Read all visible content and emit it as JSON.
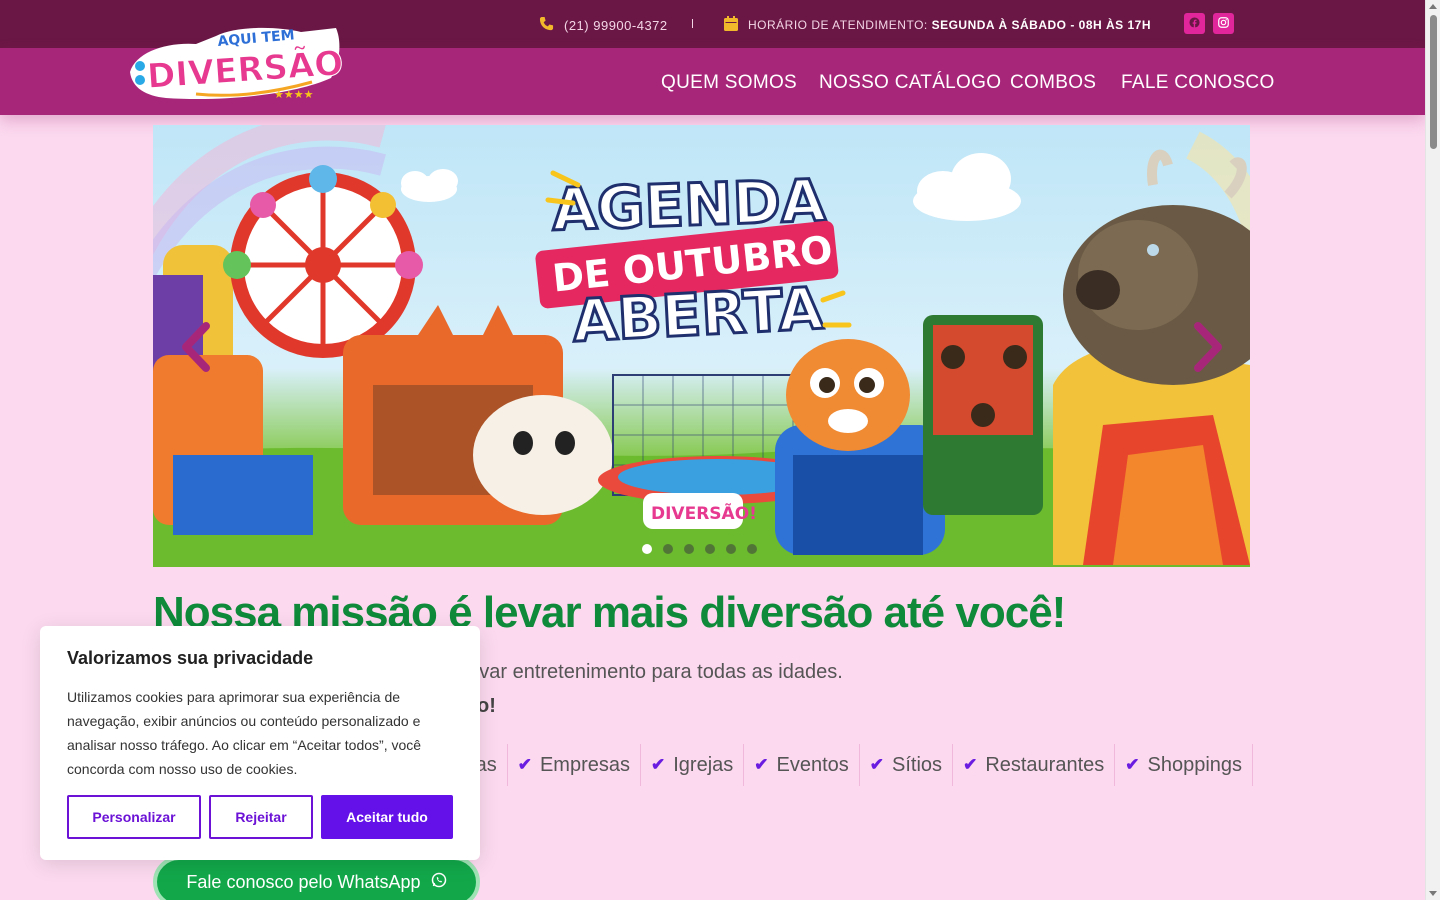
{
  "topbar": {
    "phone": "(21) 99900-4372",
    "hours_label": "HORÁRIO DE ATENDIMENTO:",
    "hours_value": "SEGUNDA À SÁBADO - 08H ÀS 17H"
  },
  "brand": {
    "logo_top": "AQUI TEM",
    "logo_main": "DIVERSÃO!"
  },
  "nav": {
    "items": [
      "QUEM SOMOS",
      "NOSSO CATÁLOGO",
      "COMBOS",
      "FALE CONOSCO"
    ]
  },
  "hero": {
    "line1": "AGENDA",
    "line2": "DE OUTUBRO",
    "line3": "ABERTA",
    "slide_count": 6,
    "active_slide": 1
  },
  "content": {
    "mission_title": "Nossa missão é levar mais diversão até você!",
    "desc1_visible": "e levar entretenimento para todas as idades.",
    "desc2_visible": "ento!",
    "venues": [
      "scolas",
      "Empresas",
      "Igrejas",
      "Eventos",
      "Sítios",
      "Restaurantes",
      "Shoppings"
    ],
    "whatsapp_button": "Fale conosco pelo WhatsApp"
  },
  "cookie": {
    "title": "Valorizamos sua privacidade",
    "body": "Utilizamos cookies para aprimorar sua experiência de navegação, exibir anúncios ou conteúdo personalizado e analisar nosso tráfego. Ao clicar em “Aceitar todos”, você concorda com nosso uso de cookies.",
    "btn_customize": "Personalizar",
    "btn_reject": "Rejeitar",
    "btn_accept": "Aceitar tudo"
  },
  "colors": {
    "topbar": "#6b1745",
    "navbar": "#a8267a",
    "page_bg": "#fcd9ef",
    "mission_green": "#0e8a3a",
    "check_purple": "#6a1de0",
    "whatsapp_green": "#12a84a",
    "cookie_primary": "#6410e8"
  }
}
